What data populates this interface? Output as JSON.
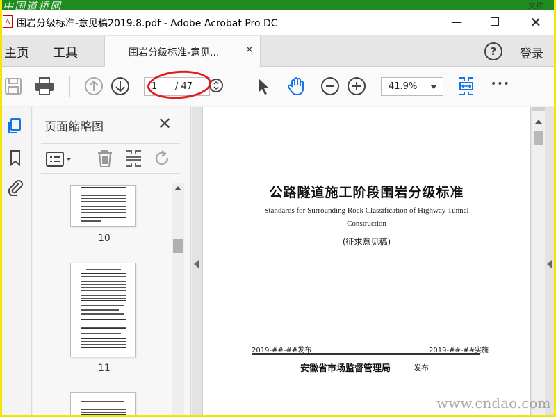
{
  "watermark_top": "中国道桥网",
  "menu_file": "文件",
  "window": {
    "title": "围岩分级标准-意见稿2019.8.pdf - Adobe Acrobat Pro DC",
    "min": "—",
    "close": "✕"
  },
  "tabs": {
    "home": "主页",
    "tools": "工具",
    "doc_tab": "围岩分级标准-意见...",
    "doc_close": "✕",
    "help": "?",
    "login": "登录"
  },
  "toolbar": {
    "current_page": "1",
    "total_pages": "/ 47",
    "zoom": "41.9%",
    "more": "•••"
  },
  "thumbnails": {
    "title": "页面缩略图",
    "close": "✕",
    "pages": [
      {
        "num": "10"
      },
      {
        "num": "11"
      }
    ]
  },
  "document": {
    "title": "公路隧道施工阶段围岩分级标准",
    "en_line1": "Standards for Surrounding Rock Classification of Highway Tunnel",
    "en_line2": "Construction",
    "draft": "(征求意见稿)",
    "publish_date": "2019-##-##发布",
    "implement_date": "2019-##-##实施",
    "org": "安徽省市场监督管理局",
    "org_pub": "发布"
  },
  "watermark_bottom": "www.cndao.com",
  "colors": {
    "accent_blue": "#1473e6",
    "annotation_red": "#e02020",
    "frame_yellow": "#f5e600"
  }
}
